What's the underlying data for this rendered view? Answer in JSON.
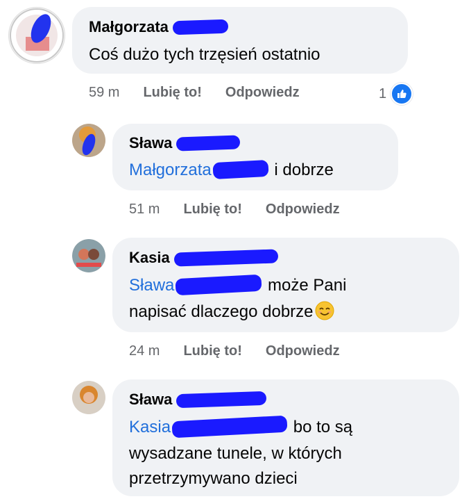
{
  "comments": [
    {
      "author": "Małgorzata",
      "text": "Coś dużo tych trzęsień ostatnio",
      "time": "59 m",
      "like_label": "Lubię to!",
      "reply_label": "Odpowiedz",
      "reaction_count": "1"
    },
    {
      "author": "Sława",
      "mention": "Małgorzata",
      "text": "i dobrze",
      "time": "51 m",
      "like_label": "Lubię to!",
      "reply_label": "Odpowiedz"
    },
    {
      "author": "Kasia",
      "mention": "Sława",
      "text_line1": "może Pani",
      "text_line2": "napisać dlaczego dobrze",
      "time": "24 m",
      "like_label": "Lubię to!",
      "reply_label": "Odpowiedz"
    },
    {
      "author": "Sława",
      "mention": "Kasia",
      "text_line1": "bo to są",
      "text_line2": "wysadzane tunele, w których",
      "text_line3": "przetrzymywano dzieci"
    }
  ],
  "colors": {
    "bubble": "#f0f2f5",
    "mention": "#216fdb",
    "meta": "#65676b",
    "redaction": "#1a1aff",
    "like": "#1877f2"
  },
  "icons": [
    "like-thumb-icon",
    "smiling-face-emoji"
  ]
}
